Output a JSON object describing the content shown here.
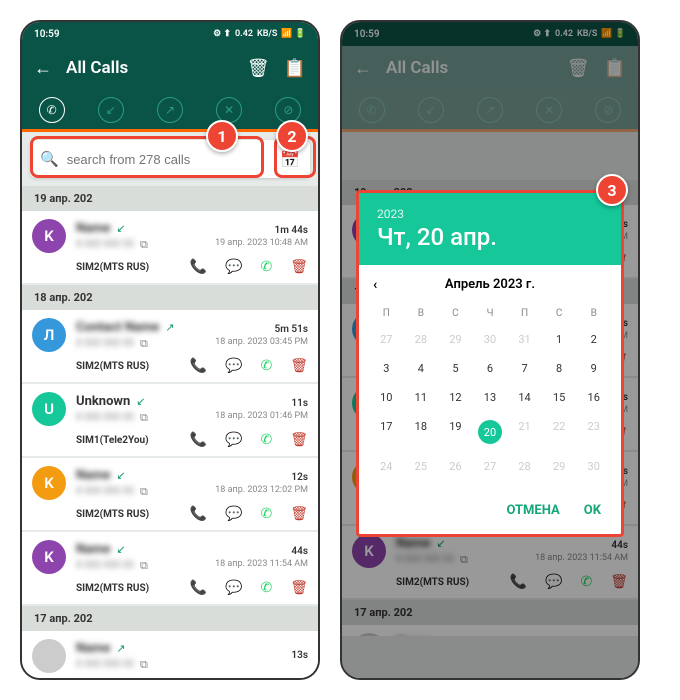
{
  "status": {
    "time": "10:59",
    "net": "0.42",
    "unit": "KB/S",
    "sig": "⬚ ▮|| ⬚▮"
  },
  "app": {
    "title": "All Calls"
  },
  "search": {
    "placeholder": "search from 278 calls"
  },
  "badges": {
    "b1": "1",
    "b2": "2",
    "b3": "3"
  },
  "groups": [
    {
      "date": "19 апр. 202",
      "items": [
        {
          "avatar": "K",
          "color": "#8e44ad",
          "name": "Name",
          "dir": "↙",
          "dur": "1m 44s",
          "ts": "19 апр. 2023 10:48 AM",
          "sim": "SIM2(MTS RUS)"
        }
      ]
    },
    {
      "date": "18 апр. 202",
      "items": [
        {
          "avatar": "Л",
          "color": "#3498db",
          "name": "Contact Name",
          "dir": "↗",
          "dur": "5m 51s",
          "ts": "18 апр. 2023 03:45 PM",
          "sim": "SIM2(MTS RUS)"
        },
        {
          "avatar": "U",
          "color": "#16c79a",
          "name": "Unknown",
          "dir": "↙",
          "nb": true,
          "dur": "11s",
          "ts": "18 апр. 2023 01:46 PM",
          "sim": "SIM1(Tele2You)"
        },
        {
          "avatar": "K",
          "color": "#f39c12",
          "name": "Name",
          "dir": "↙",
          "dur": "12s",
          "ts": "18 апр. 2023 12:02 PM",
          "sim": "SIM2(MTS RUS)"
        },
        {
          "avatar": "K",
          "color": "#8e44ad",
          "name": "Name",
          "dir": "↙",
          "dur": "44s",
          "ts": "18 апр. 2023 11:54 AM",
          "sim": "SIM2(MTS RUS)"
        }
      ]
    },
    {
      "date": "17 апр. 202",
      "items": [
        {
          "avatar": " ",
          "color": "#ccc",
          "name": "Name",
          "dir": "↗",
          "dur": "13s",
          "ts": "",
          "sim": ""
        }
      ]
    }
  ],
  "picker": {
    "year": "2023",
    "full": "Чт, 20 апр.",
    "month": "Апрель 2023 г.",
    "dow": [
      "П",
      "В",
      "С",
      "Ч",
      "П",
      "С",
      "В"
    ],
    "days": [
      {
        "d": "27",
        "m": 1
      },
      {
        "d": "28",
        "m": 1
      },
      {
        "d": "29",
        "m": 1
      },
      {
        "d": "30",
        "m": 1
      },
      {
        "d": "31",
        "m": 1
      },
      {
        "d": "1"
      },
      {
        "d": "2"
      },
      {
        "d": "3"
      },
      {
        "d": "4"
      },
      {
        "d": "5"
      },
      {
        "d": "6"
      },
      {
        "d": "7"
      },
      {
        "d": "8"
      },
      {
        "d": "9"
      },
      {
        "d": "10"
      },
      {
        "d": "11"
      },
      {
        "d": "12"
      },
      {
        "d": "13"
      },
      {
        "d": "14"
      },
      {
        "d": "15"
      },
      {
        "d": "16"
      },
      {
        "d": "17"
      },
      {
        "d": "18"
      },
      {
        "d": "19"
      },
      {
        "d": "20",
        "s": 1
      },
      {
        "d": "21",
        "m": 1
      },
      {
        "d": "22",
        "m": 1
      },
      {
        "d": "23",
        "m": 1
      },
      {
        "d": "24",
        "m": 1
      },
      {
        "d": "25",
        "m": 1
      },
      {
        "d": "26",
        "m": 1
      },
      {
        "d": "27",
        "m": 1
      },
      {
        "d": "28",
        "m": 1
      },
      {
        "d": "29",
        "m": 1
      },
      {
        "d": "30",
        "m": 1
      }
    ],
    "cancel": "ОТМЕНА",
    "ok": "OK"
  }
}
